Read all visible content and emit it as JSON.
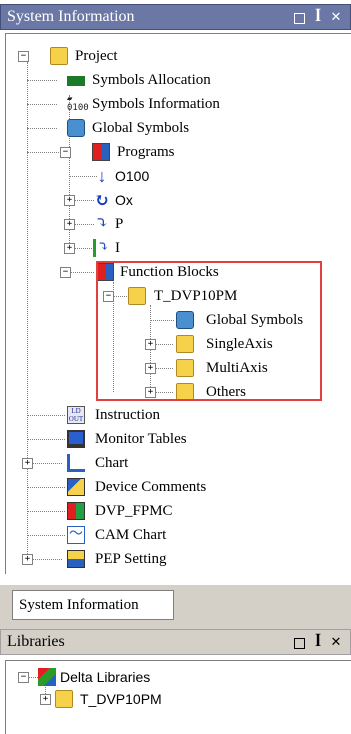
{
  "system_panel": {
    "title": "System Information",
    "controls": [
      "□",
      "ꟾ",
      "×"
    ]
  },
  "tree": {
    "project": "Project",
    "symbols_allocation": "Symbols Allocation",
    "symbols_information": "Symbols Information",
    "global_symbols": "Global Symbols",
    "programs": "Programs",
    "o100": "O100",
    "ox": "Ox",
    "p": "P",
    "i": "I",
    "function_blocks": "Function Blocks",
    "t_dvp10pm": "T_DVP10PM",
    "fb_global_symbols": "Global Symbols",
    "single_axis": "SingleAxis",
    "multi_axis": "MultiAxis",
    "others": "Others",
    "instruction": "Instruction",
    "monitor_tables": "Monitor Tables",
    "chart": "Chart",
    "device_comments": "Device Comments",
    "dvp_fpmc": "DVP_FPMC",
    "cam_chart": "CAM Chart",
    "pep_setting": "PEP Setting"
  },
  "tab": {
    "label": "System Information"
  },
  "libraries_panel": {
    "title": "Libraries",
    "delta_libraries": "Delta Libraries",
    "t_dvp10pm": "T_DVP10PM"
  },
  "colors": {
    "title_bar": "#6b78a6",
    "highlight_border": "#e04040",
    "folder_yellow": "#f6d24a"
  }
}
